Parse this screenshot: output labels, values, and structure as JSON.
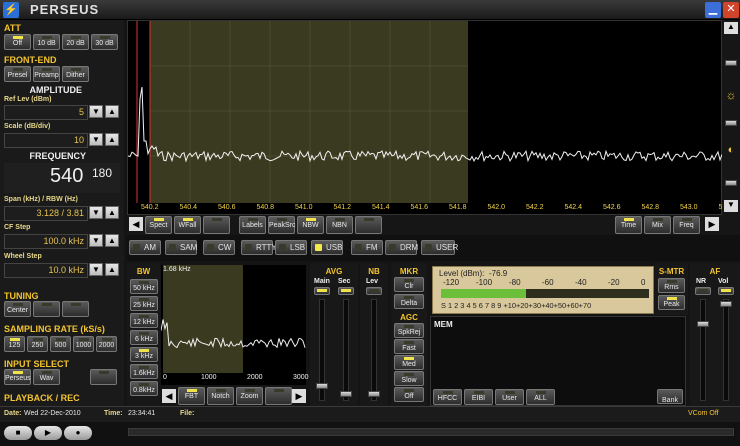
{
  "window": {
    "title": "PERSEUS",
    "icon": "app-icon",
    "min_icon": "minimize-icon",
    "close_icon": "close-icon"
  },
  "att": {
    "title": "ATT",
    "buttons": [
      "Off",
      "10 dB",
      "20 dB",
      "30 dB"
    ],
    "active": 0
  },
  "frontend": {
    "title": "FRONT-END",
    "buttons": [
      "Presel",
      "Preamp",
      "Dither"
    ]
  },
  "amplitude": {
    "title": "AMPLITUDE",
    "ref_label": "Ref Lev (dBm)",
    "ref_value": "5",
    "scale_label": "Scale (dB/div)",
    "scale_value": "10"
  },
  "frequency": {
    "title": "FREQUENCY",
    "main": "540",
    "fraction": "180",
    "span_label": "Span (kHz) / RBW (Hz)",
    "span_value": "3.128 / 3.81",
    "cfstep_label": "CF Step",
    "cfstep_value": "100.0 kHz",
    "wheel_label": "Wheel Step",
    "wheel_value": "10.0 kHz"
  },
  "tuning": {
    "title": "TUNING",
    "buttons": [
      "Center",
      "",
      ""
    ]
  },
  "sampling": {
    "title": "SAMPLING RATE (kS/s)",
    "buttons": [
      "125",
      "250",
      "500",
      "1000",
      "2000"
    ],
    "active": 0
  },
  "input": {
    "title": "INPUT SELECT",
    "buttons": [
      "Perseus",
      "Wav",
      ""
    ]
  },
  "playback": {
    "title": "PLAYBACK / REC"
  },
  "spectrum": {
    "ticks": [
      "540.2",
      "540.4",
      "540.6",
      "540.8",
      "541.0",
      "541.2",
      "541.4",
      "541.6",
      "541.8",
      "542.0",
      "542.2",
      "542.4",
      "542.6",
      "542.8",
      "543.0",
      "543.2"
    ]
  },
  "spectrum_bar": {
    "left": [
      "Spect",
      "WFall",
      ""
    ],
    "mid": [
      "Labels",
      "PeakSrc",
      "NBW",
      "NBN",
      ""
    ],
    "right": [
      "Time",
      "Mix",
      "Freq"
    ]
  },
  "modes": [
    {
      "label": "AM",
      "on": false
    },
    {
      "label": "SAM",
      "on": false
    },
    {
      "label": "CW",
      "on": false
    },
    {
      "label": "RTTY",
      "on": false
    },
    {
      "label": "LSB",
      "on": false
    },
    {
      "label": "USB",
      "on": true
    },
    {
      "label": "FM",
      "on": false
    },
    {
      "label": "DRM",
      "on": false
    },
    {
      "label": "USER",
      "on": false
    }
  ],
  "bw": {
    "title": "BW",
    "buttons": [
      "50 kHz",
      "25 kHz",
      "12 kHz",
      "6 kHz",
      "3 kHz",
      "1.6kHz",
      "0.8kHz"
    ],
    "display": "1.68 kHz",
    "axis": [
      "0",
      "1000",
      "2000",
      "3000"
    ],
    "bar": [
      "FBT",
      "Notch",
      "Zoom",
      ""
    ]
  },
  "avg": {
    "title": "AVG",
    "main": "Main",
    "sec": "Sec"
  },
  "nb": {
    "title": "NB",
    "lev": "Lev"
  },
  "mkr": {
    "title": "MKR",
    "buttons": [
      "Clr",
      "Delta"
    ]
  },
  "agc": {
    "title": "AGC",
    "buttons": [
      "SpkRej",
      "Fast",
      "Med",
      "Slow",
      "Off"
    ]
  },
  "smeter": {
    "level_label": "Level (dBm):",
    "level_value": "-76.9",
    "dbm_scale": [
      "-120",
      "-100",
      "-80",
      "-60",
      "-40",
      "-20",
      "0"
    ],
    "s_scale": "S 1 2 3 4 5 6 7 8 9 +10+20+30+40+50+60+70",
    "title": "S-MTR",
    "buttons": [
      "Rms",
      "Peak"
    ]
  },
  "af": {
    "title": "AF",
    "nr": "NR",
    "vol": "Vol"
  },
  "mem": {
    "title": "MEM",
    "buttons": [
      "HFCC",
      "EIBI",
      "User",
      "ALL"
    ],
    "bank": "Bank"
  },
  "status": {
    "date_label": "Date:",
    "date": "Wed 22-Dec-2010",
    "time_label": "Time:",
    "time": "23:34:41",
    "file_label": "File:",
    "vcom": "VCom Off"
  },
  "colors": {
    "accent": "#f4c430",
    "led_on": "#f1e14b",
    "spectrum_bg": "#3a3a21"
  }
}
